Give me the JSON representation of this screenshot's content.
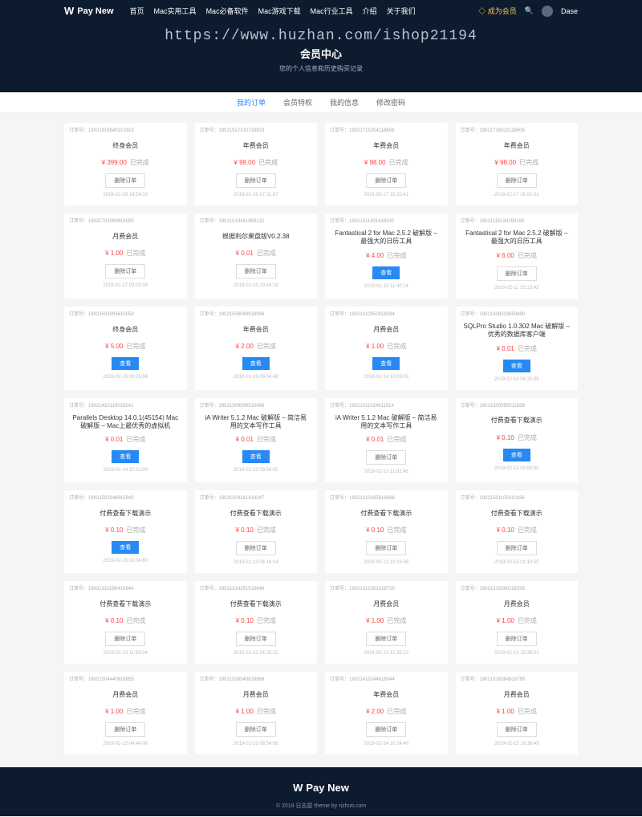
{
  "header": {
    "logo": "Pay New",
    "nav": [
      "首页",
      "Mac实用工具",
      "Mac必备软件",
      "Mac游戏下载",
      "Mac行业工具",
      "介绍",
      "关于我们"
    ],
    "vip": "成为会员",
    "user": "Dase"
  },
  "hero": {
    "watermark": "https://www.huzhan.com/ishop21194",
    "title": "会员中心",
    "sub": "您的个人信息和历史购买记录"
  },
  "tabs": [
    "我的订单",
    "会员特权",
    "我的信息",
    "修改密码"
  ],
  "btn_delete": "删除订单",
  "btn_view": "查看",
  "orders": [
    {
      "no": "订单号：19021919540210310",
      "title": "终身会员",
      "price": "¥ 399.00",
      "status": "已完成",
      "action": "del",
      "date": "2019-02-19 19:54:02"
    },
    {
      "no": "订单号：19021917310718833",
      "title": "年费会员",
      "price": "¥ 98.00",
      "status": "已完成",
      "action": "del",
      "date": "2019-02-19 17:31:07"
    },
    {
      "no": "订单号：19021715204118858",
      "title": "年费会员",
      "price": "¥ 98.00",
      "status": "已完成",
      "action": "del",
      "date": "2019-02-17 15:20:41"
    },
    {
      "no": "订单号：19021716010118506",
      "title": "年费会员",
      "price": "¥ 98.00",
      "status": "已完成",
      "action": "del",
      "date": "2019-02-17 16:01:01"
    },
    {
      "no": "订单号：19021703090818005",
      "title": "月费会员",
      "price": "¥ 1.00",
      "status": "已完成",
      "action": "del",
      "date": "2019-02-17 03:09:08"
    },
    {
      "no": "订单号：19021519441858132",
      "title": "根据利尔果盘版V0.2.38",
      "price": "¥ 0.01",
      "status": "已完成",
      "action": "del",
      "date": "2019-02-15 19:44:18"
    },
    {
      "no": "订单号：19021511401418542",
      "title": "Fantastical 2 for Mac 2.5.2 破解版 – 最强大的日历工具",
      "price": "¥ 4.00",
      "status": "已完成",
      "action": "view",
      "date": "2019-02-15 11:40:14"
    },
    {
      "no": "订单号：19021115134258195",
      "title": "Fantastical 2 for Mac 2.5.2 破解版 – 最强大的日历工具",
      "price": "¥ 6.00",
      "status": "已完成",
      "action": "del",
      "date": "2019-02-11 15:13:42"
    },
    {
      "no": "订单号：19021503095610058",
      "title": "终身会员",
      "price": "¥ 5.00",
      "status": "已完成",
      "action": "view",
      "date": "2019-02-15 03:09:56"
    },
    {
      "no": "订单号：19021506048918996",
      "title": "年费会员",
      "price": "¥ 2.00",
      "status": "已完成",
      "action": "view",
      "date": "2019-02-15 06:04:48"
    },
    {
      "no": "订单号：19021410050018284",
      "title": "月费会员",
      "price": "¥ 1.00",
      "status": "已完成",
      "action": "view",
      "date": "2019-02-14 10:05:00"
    },
    {
      "no": "订单号：19021408333658890",
      "title": "SQLPro Studio 1.0.302 Mac 破解版 – 优秀的数据库客户端",
      "price": "¥ 0.01",
      "status": "已完成",
      "action": "view",
      "date": "2019-02-14 08:33:36"
    },
    {
      "no": "订单号：19021410110018241",
      "title": "Parallels Desktop 14.0.1(45154) Mac 破解版 – Mac上最优秀的虚拟机",
      "price": "¥ 0.01",
      "status": "已完成",
      "action": "view",
      "date": "2019-02-14 10:11:00"
    },
    {
      "no": "订单号：19021309590510496",
      "title": "iA Writer 5.1.2 Mac 破解版 – 简洁易用的文本写作工具",
      "price": "¥ 0.01",
      "status": "已完成",
      "action": "view",
      "date": "2019-02-13 09:59:05"
    },
    {
      "no": "订单号：19021311024611514",
      "title": "iA Writer 5.1.2 Mac 破解版 – 简洁易用的文本写作工具",
      "price": "¥ 0.01",
      "status": "已完成",
      "action": "del",
      "date": "2019-02-13 11:02:46"
    },
    {
      "no": "订单号：19021300555011568",
      "title": "付费查看下载演示",
      "price": "¥ 0.10",
      "status": "已完成",
      "action": "view",
      "date": "2019-02-13 00:55:50"
    },
    {
      "no": "订单号：19021502046015943",
      "title": "付费查看下载演示",
      "price": "¥ 0.10",
      "status": "已完成",
      "action": "view",
      "date": "2019-02-15 02:04:60"
    },
    {
      "no": "订单号：19021304161418247",
      "title": "付费查看下载演示",
      "price": "¥ 0.10",
      "status": "已完成",
      "action": "del",
      "date": "2019-02-13 04:16:14"
    },
    {
      "no": "订单号：19021310165618668",
      "title": "付费查看下载演示",
      "price": "¥ 0.10",
      "status": "已完成",
      "action": "del",
      "date": "2019-02-13 10:16:56"
    },
    {
      "no": "订单号：19021501105010186",
      "title": "付费查看下载演示",
      "price": "¥ 0.10",
      "status": "已完成",
      "action": "del",
      "date": "2019-02-15 01:10:50"
    },
    {
      "no": "订单号：19021311590410944",
      "title": "付费查看下载演示",
      "price": "¥ 0.10",
      "status": "已完成",
      "action": "del",
      "date": "2019-02-13 11:59:04"
    },
    {
      "no": "订单号：19021314251518646",
      "title": "付费查看下载演示",
      "price": "¥ 0.10",
      "status": "已完成",
      "action": "del",
      "date": "2019-02-13 14:25:15"
    },
    {
      "no": "订单号：19021312352218728",
      "title": "月费会员",
      "price": "¥ 1.00",
      "status": "已完成",
      "action": "del",
      "date": "2019-02-13 12:35:22"
    },
    {
      "no": "订单号：19021315380118258",
      "title": "月费会员",
      "price": "¥ 1.00",
      "status": "已完成",
      "action": "del",
      "date": "2019-02-13 15:38:01"
    },
    {
      "no": "订单号：19021504440618855",
      "title": "月费会员",
      "price": "¥ 1.00",
      "status": "已完成",
      "action": "del",
      "date": "2019-02-15 04:44:06"
    },
    {
      "no": "订单号：19021508540618968",
      "title": "月费会员",
      "price": "¥ 1.00",
      "status": "已完成",
      "action": "del",
      "date": "2019-02-15 08:54:06"
    },
    {
      "no": "订单号：19021410244618044",
      "title": "年费会员",
      "price": "¥ 2.00",
      "status": "已完成",
      "action": "del",
      "date": "2019-02-14 10:24:46"
    },
    {
      "no": "订单号：19021516384918795",
      "title": "月费会员",
      "price": "¥ 1.00",
      "status": "已完成",
      "action": "del",
      "date": "2019-02-15 16:38:49"
    }
  ],
  "footer": {
    "logo": "Pay New",
    "copyright": "© 2019 日志屋 theme by rizhuti.com"
  }
}
